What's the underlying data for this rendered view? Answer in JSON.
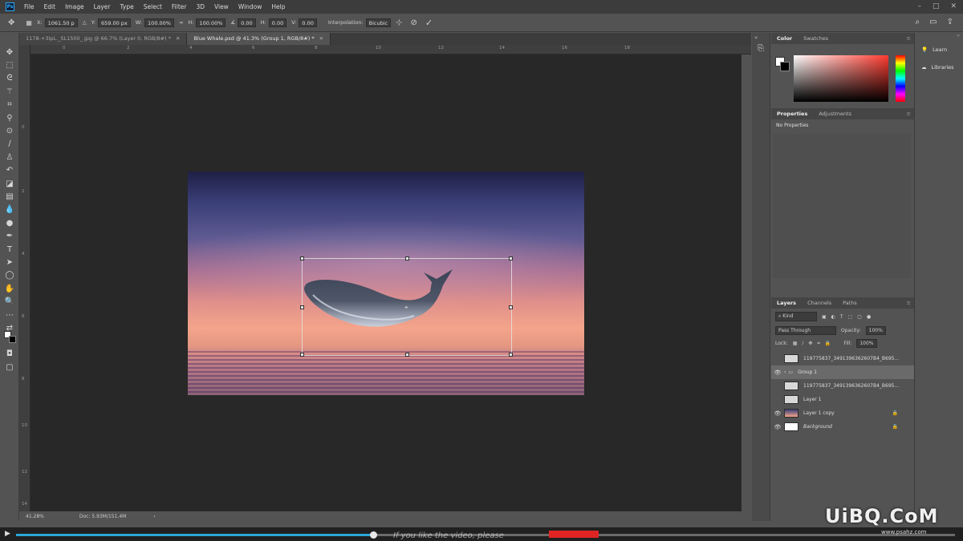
{
  "menubar": {
    "logo": "Ps",
    "items": [
      "File",
      "Edit",
      "Image",
      "Layer",
      "Type",
      "Select",
      "Filter",
      "3D",
      "View",
      "Window",
      "Help"
    ]
  },
  "options": {
    "x_label": "X:",
    "x_value": "1061.50 p",
    "y_label": "Y:",
    "y_value": "659.00 px",
    "w_label": "W:",
    "w_value": "100.00%",
    "h_label": "H:",
    "h_value": "100.00%",
    "angle_value": "0.00",
    "hskew_label": "H:",
    "hskew_value": "0.00",
    "vskew_label": "V:",
    "vskew_value": "0.00",
    "interp_label": "Interpolation:",
    "interp_value": "Bicubic"
  },
  "tabs": [
    {
      "label": "1178-+3ipL._SL1500_.jpg @ 66.7% (Layer 0, RGB/8#) *",
      "active": false
    },
    {
      "label": "Blue Whale.psd @ 41.3% (Group 1, RGB/8#) *",
      "active": true
    }
  ],
  "ruler": {
    "top": [
      "0",
      "2",
      "4",
      "6",
      "8",
      "10",
      "12",
      "14",
      "16",
      "18"
    ],
    "left": [
      "0",
      "2",
      "4",
      "6",
      "8",
      "10",
      "12",
      "14"
    ]
  },
  "status": {
    "zoom": "41.28%",
    "doc": "Doc: 5.93M/151.4M"
  },
  "color_panel": {
    "tab1": "Color",
    "tab2": "Swatches"
  },
  "properties_panel": {
    "tab1": "Properties",
    "tab2": "Adjustments",
    "body": "No Properties"
  },
  "layers_panel": {
    "tabs": [
      "Layers",
      "Channels",
      "Paths"
    ],
    "kind": "Kind",
    "blend": "Pass Through",
    "opacity_label": "Opacity:",
    "opacity_value": "100%",
    "lock_label": "Lock:",
    "fill_label": "Fill:",
    "fill_value": "100%",
    "layers": [
      {
        "name": "119775837_3491396362607B4_B695...",
        "visible": false,
        "selected": false,
        "thumb": "#d8d8d8"
      },
      {
        "name": "Group 1",
        "visible": true,
        "selected": true,
        "thumb": "#9a9a9a"
      },
      {
        "name": "119775837_3491396362607B4_B695...",
        "visible": false,
        "selected": false,
        "thumb": "#d8d8d8"
      },
      {
        "name": "Layer 1",
        "visible": false,
        "selected": false,
        "thumb": "#d8d8d8"
      },
      {
        "name": "Layer 1 copy",
        "visible": true,
        "selected": false,
        "thumb": "#b67a9e"
      },
      {
        "name": "Background",
        "visible": true,
        "selected": false,
        "thumb": "#ffffff"
      }
    ]
  },
  "right_panel": {
    "items": [
      "Learn",
      "Libraries"
    ]
  },
  "video": {
    "caption": "If you like the video, please",
    "progress": 0.38
  },
  "watermark": {
    "text": "UiBQ.CoM",
    "url": "www.psahz.com"
  }
}
